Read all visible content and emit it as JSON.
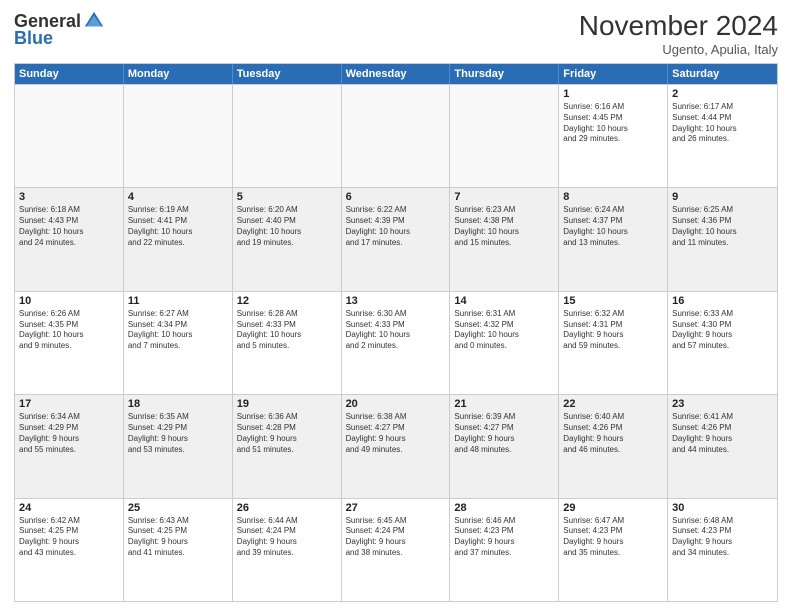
{
  "logo": {
    "general": "General",
    "blue": "Blue"
  },
  "title": "November 2024",
  "location": "Ugento, Apulia, Italy",
  "days_of_week": [
    "Sunday",
    "Monday",
    "Tuesday",
    "Wednesday",
    "Thursday",
    "Friday",
    "Saturday"
  ],
  "rows": [
    [
      {
        "day": "",
        "empty": true
      },
      {
        "day": "",
        "empty": true
      },
      {
        "day": "",
        "empty": true
      },
      {
        "day": "",
        "empty": true
      },
      {
        "day": "",
        "empty": true
      },
      {
        "day": "1",
        "info": "Sunrise: 6:16 AM\nSunset: 4:45 PM\nDaylight: 10 hours\nand 29 minutes."
      },
      {
        "day": "2",
        "info": "Sunrise: 6:17 AM\nSunset: 4:44 PM\nDaylight: 10 hours\nand 26 minutes."
      }
    ],
    [
      {
        "day": "3",
        "info": "Sunrise: 6:18 AM\nSunset: 4:43 PM\nDaylight: 10 hours\nand 24 minutes."
      },
      {
        "day": "4",
        "info": "Sunrise: 6:19 AM\nSunset: 4:41 PM\nDaylight: 10 hours\nand 22 minutes."
      },
      {
        "day": "5",
        "info": "Sunrise: 6:20 AM\nSunset: 4:40 PM\nDaylight: 10 hours\nand 19 minutes."
      },
      {
        "day": "6",
        "info": "Sunrise: 6:22 AM\nSunset: 4:39 PM\nDaylight: 10 hours\nand 17 minutes."
      },
      {
        "day": "7",
        "info": "Sunrise: 6:23 AM\nSunset: 4:38 PM\nDaylight: 10 hours\nand 15 minutes."
      },
      {
        "day": "8",
        "info": "Sunrise: 6:24 AM\nSunset: 4:37 PM\nDaylight: 10 hours\nand 13 minutes."
      },
      {
        "day": "9",
        "info": "Sunrise: 6:25 AM\nSunset: 4:36 PM\nDaylight: 10 hours\nand 11 minutes."
      }
    ],
    [
      {
        "day": "10",
        "info": "Sunrise: 6:26 AM\nSunset: 4:35 PM\nDaylight: 10 hours\nand 9 minutes."
      },
      {
        "day": "11",
        "info": "Sunrise: 6:27 AM\nSunset: 4:34 PM\nDaylight: 10 hours\nand 7 minutes."
      },
      {
        "day": "12",
        "info": "Sunrise: 6:28 AM\nSunset: 4:33 PM\nDaylight: 10 hours\nand 5 minutes."
      },
      {
        "day": "13",
        "info": "Sunrise: 6:30 AM\nSunset: 4:33 PM\nDaylight: 10 hours\nand 2 minutes."
      },
      {
        "day": "14",
        "info": "Sunrise: 6:31 AM\nSunset: 4:32 PM\nDaylight: 10 hours\nand 0 minutes."
      },
      {
        "day": "15",
        "info": "Sunrise: 6:32 AM\nSunset: 4:31 PM\nDaylight: 9 hours\nand 59 minutes."
      },
      {
        "day": "16",
        "info": "Sunrise: 6:33 AM\nSunset: 4:30 PM\nDaylight: 9 hours\nand 57 minutes."
      }
    ],
    [
      {
        "day": "17",
        "info": "Sunrise: 6:34 AM\nSunset: 4:29 PM\nDaylight: 9 hours\nand 55 minutes."
      },
      {
        "day": "18",
        "info": "Sunrise: 6:35 AM\nSunset: 4:29 PM\nDaylight: 9 hours\nand 53 minutes."
      },
      {
        "day": "19",
        "info": "Sunrise: 6:36 AM\nSunset: 4:28 PM\nDaylight: 9 hours\nand 51 minutes."
      },
      {
        "day": "20",
        "info": "Sunrise: 6:38 AM\nSunset: 4:27 PM\nDaylight: 9 hours\nand 49 minutes."
      },
      {
        "day": "21",
        "info": "Sunrise: 6:39 AM\nSunset: 4:27 PM\nDaylight: 9 hours\nand 48 minutes."
      },
      {
        "day": "22",
        "info": "Sunrise: 6:40 AM\nSunset: 4:26 PM\nDaylight: 9 hours\nand 46 minutes."
      },
      {
        "day": "23",
        "info": "Sunrise: 6:41 AM\nSunset: 4:26 PM\nDaylight: 9 hours\nand 44 minutes."
      }
    ],
    [
      {
        "day": "24",
        "info": "Sunrise: 6:42 AM\nSunset: 4:25 PM\nDaylight: 9 hours\nand 43 minutes."
      },
      {
        "day": "25",
        "info": "Sunrise: 6:43 AM\nSunset: 4:25 PM\nDaylight: 9 hours\nand 41 minutes."
      },
      {
        "day": "26",
        "info": "Sunrise: 6:44 AM\nSunset: 4:24 PM\nDaylight: 9 hours\nand 39 minutes."
      },
      {
        "day": "27",
        "info": "Sunrise: 6:45 AM\nSunset: 4:24 PM\nDaylight: 9 hours\nand 38 minutes."
      },
      {
        "day": "28",
        "info": "Sunrise: 6:46 AM\nSunset: 4:23 PM\nDaylight: 9 hours\nand 37 minutes."
      },
      {
        "day": "29",
        "info": "Sunrise: 6:47 AM\nSunset: 4:23 PM\nDaylight: 9 hours\nand 35 minutes."
      },
      {
        "day": "30",
        "info": "Sunrise: 6:48 AM\nSunset: 4:23 PM\nDaylight: 9 hours\nand 34 minutes."
      }
    ]
  ]
}
